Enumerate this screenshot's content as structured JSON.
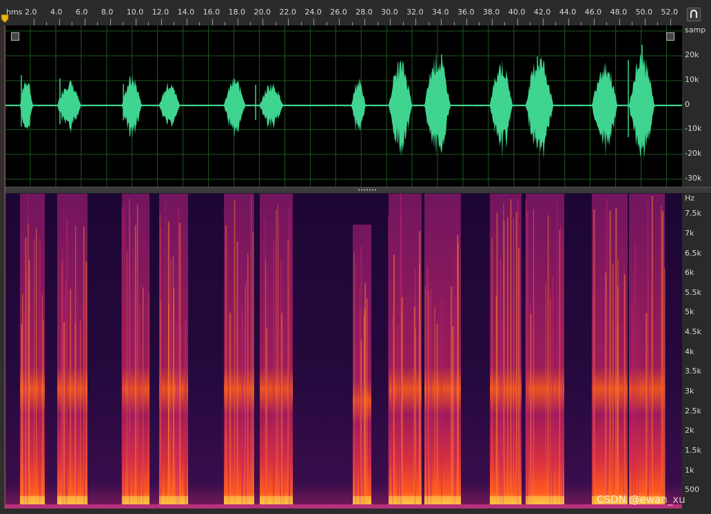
{
  "ruler": {
    "unit": "hms",
    "labels": [
      "2.0",
      "4.0",
      "6.0",
      "8.0",
      "10.0",
      "12.0",
      "14.0",
      "16.0",
      "18.0",
      "20.0",
      "22.0",
      "24.0",
      "26.0",
      "28.0",
      "30.0",
      "32.0",
      "34.0",
      "36.0",
      "38.0",
      "40.0",
      "42.0",
      "44.0",
      "46.0",
      "48.0",
      "50.0",
      "52.0"
    ]
  },
  "waveform": {
    "color": "#3fd48f",
    "unit": "samp",
    "axis_labels": [
      "20k",
      "10k",
      "0",
      "-10k",
      "-20k",
      "-30k"
    ],
    "grid_color": "#1f5a1f"
  },
  "spectrogram": {
    "unit": "Hz",
    "axis_labels": [
      "7.5k",
      "7k",
      "6.5k",
      "6k",
      "5.5k",
      "5k",
      "4.5k",
      "4k",
      "3.5k",
      "3k",
      "2.5k",
      "2k",
      "1.5k",
      "1k",
      "500"
    ]
  },
  "watermark": "CSDN @ewan_xu",
  "icons": {
    "snap": "magnet-icon",
    "playhead": "playhead-marker-icon",
    "zoom_in": "zoom-corner-icon"
  },
  "colors": {
    "spec_bg": "#1a0630",
    "spec_mid": "#8e1a6e",
    "spec_hot": "#ff5a1f",
    "spec_peak": "#ffd24a"
  }
}
